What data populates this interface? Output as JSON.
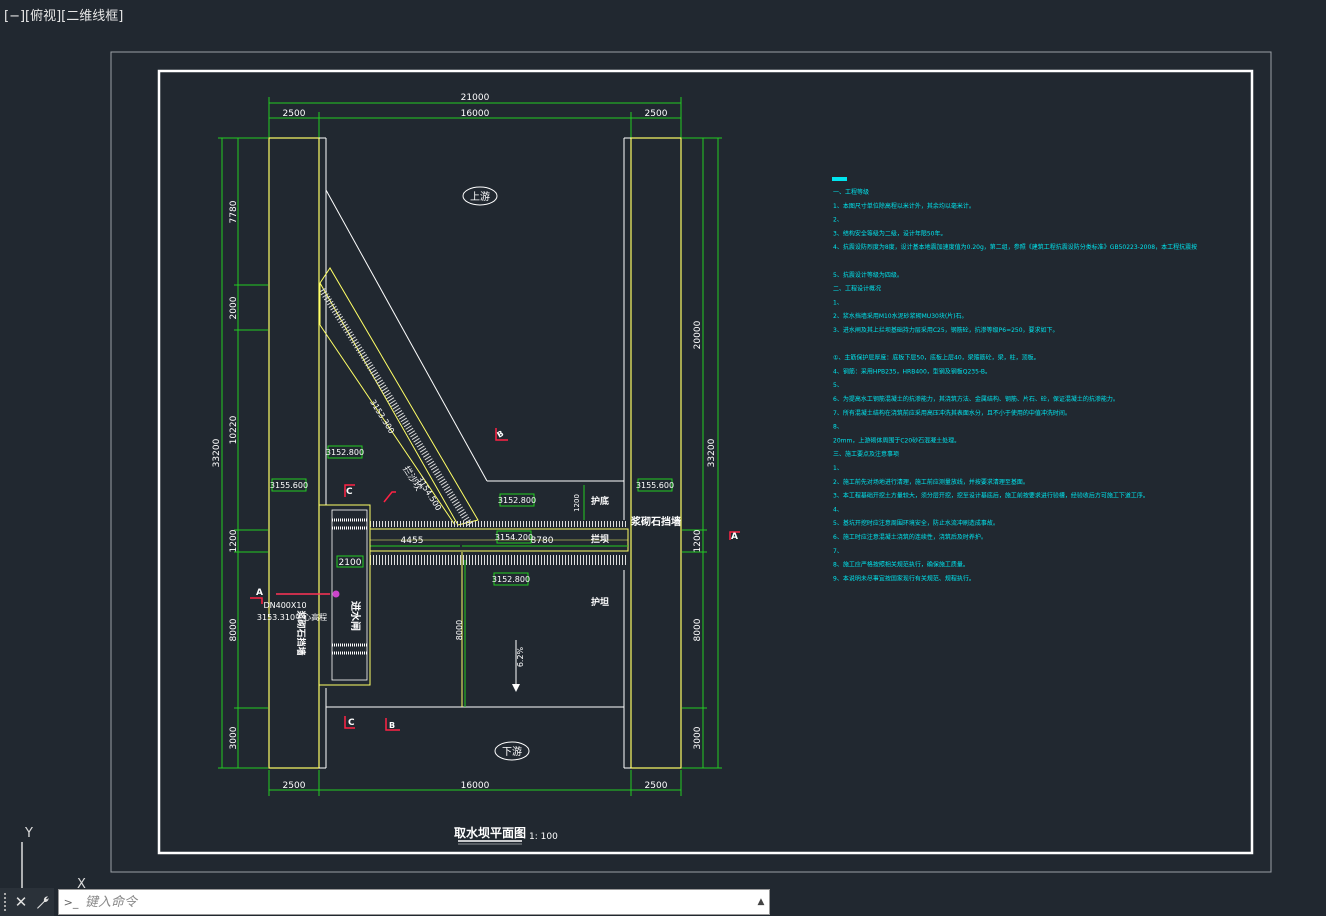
{
  "viewport": {
    "label": "[−][俯视][二维线框]"
  },
  "ucs": {
    "y": "Y",
    "x": "X"
  },
  "drawing": {
    "title": "取水坝平面图",
    "scale": "1: 100",
    "dims_top": {
      "total": "21000",
      "left": "2500",
      "middle": "16000",
      "right": "2500"
    },
    "dims_bottom": {
      "left": "2500",
      "middle": "16000",
      "right": "2500"
    },
    "dims_left": {
      "total": "33200",
      "s1": "7780",
      "s2": "2000",
      "s3": "10220",
      "s4": "1200",
      "s5": "8000",
      "s6": "3000"
    },
    "dims_right": {
      "total": "33200",
      "s1": "20000",
      "s2": "1200",
      "s3": "8000",
      "s4": "3000"
    },
    "dims_inner": {
      "d4455": "4455",
      "d8780": "8780",
      "d2100": "2100",
      "d8000": "8000",
      "d1200": "1200"
    },
    "elevations": {
      "left_wall": "3155.600",
      "right_wall": "3155.600",
      "up_area": "3152.800",
      "weir_up": "3152.800",
      "weir_crest": "3154.200",
      "down_area": "3152.800",
      "diag1": "3153.300",
      "diag2": "3154.500"
    },
    "labels": {
      "upstream": "上游",
      "downstream": "下游",
      "apron_up": "护底",
      "weir": "拦坝",
      "apron_down": "护坦",
      "right_wall": "浆砌石挡墙",
      "left_wall": "浆砌石挡墙",
      "intake": "进水闸",
      "diag_weir": "拦沙坎",
      "pipe": "DN400X10",
      "pipe_elev": "3153.310中心高程",
      "slope": "6.2%",
      "sec_A": "A",
      "sec_B": "B",
      "sec_C": "C"
    },
    "notes": [
      "一、工程等级",
      "1、本图尺寸单位除高程以米计外，其余均以毫米计。",
      "2、",
      "3、结构安全等级为二级，设计年限50年。",
      "4、抗震设防烈度为8度，设计基本地震加速度值为0.20g，第二组，参照《建筑工程抗震设防分类标准》GB50223-2008，本工程抗震按",
      "",
      "5、抗震设计等级为四级。",
      "二、工程设计概况",
      "1、",
      "2、浆水挡墙采用M10水泥砂浆砌MU30块(片)石。",
      "3、进水闸及其上拦坝基础持力层采用C25，钢筋砼，抗渗等级P6=250，要求如下。",
      "",
      "①、主筋保护层厚度：底板下层50，底板上层40，梁箍筋砼，梁，柱，顶板。",
      "4、钢筋：采用HPB235，HRB400，型钢及钢板Q235-B。",
      "5、",
      "6、为提高水工钢筋混凝土的抗渗能力，其浇筑方法、金属结构、钢筋、片石、砼，保证混凝土的抗渗能力。",
      "7、所有混凝土结构在浇筑前应采用高压冲洗其表面水分，且不小于使用的中值冲洗时间。",
      "8、",
      "20mm，上游砌体周围于C20砂石混凝土处理。",
      "三、施工要点及注意事项",
      "1、",
      "2、施工前先对场地进行清理，施工前应测量放线，并按要求清理至基面。",
      "3、本工程基础开挖土方量较大，须分层开挖，挖至设计基底后，施工前按要求进行验槽，经验收后方可施工下道工序。",
      "4、",
      "5、基坑开挖时应注意周围环境安全，防止水流冲刷造成事故。",
      "6、施工时应注意混凝土浇筑的连续性，浇筑后及时养护。",
      "7、",
      "8、施工应严格按照相关规范执行，确保施工质量。",
      "9、本说明未尽事宜按国家现行有关规范、规程执行。"
    ]
  },
  "command": {
    "placeholder": "键入命令",
    "prompt_icon": ">_"
  }
}
